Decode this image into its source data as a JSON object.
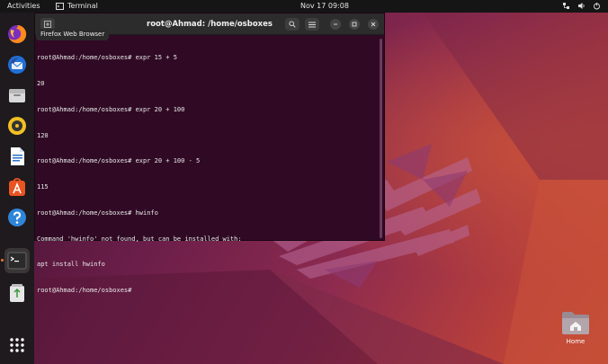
{
  "topbar": {
    "activities": "Activities",
    "app_name": "Terminal",
    "clock": "Nov 17  09:08"
  },
  "dock": {
    "items": [
      {
        "name": "firefox-icon"
      },
      {
        "name": "thunderbird-icon"
      },
      {
        "name": "files-icon"
      },
      {
        "name": "rhythmbox-icon"
      },
      {
        "name": "libreoffice-writer-icon"
      },
      {
        "name": "app-center-icon"
      },
      {
        "name": "help-icon"
      },
      {
        "name": "terminal-icon"
      },
      {
        "name": "trash-icon"
      },
      {
        "name": "show-apps-icon"
      }
    ],
    "tooltip": "Firefox Web Browser"
  },
  "terminal": {
    "title": "root@Ahmad: /home/osboxes",
    "lines": [
      "root@Ahmad:/home/osboxes# expr 15 + 5",
      "20",
      "root@Ahmad:/home/osboxes# expr 20 + 100",
      "120",
      "root@Ahmad:/home/osboxes# expr 20 + 100 - 5",
      "115",
      "root@Ahmad:/home/osboxes# hwinfo",
      "Command 'hwinfo' not found, but can be installed with:",
      "apt install hwinfo",
      "root@Ahmad:/home/osboxes# "
    ]
  },
  "desktop": {
    "home_label": "Home"
  },
  "colors": {
    "terminal_bg": "#300a24",
    "accent": "#f07830",
    "topbar_bg": "#151515"
  }
}
